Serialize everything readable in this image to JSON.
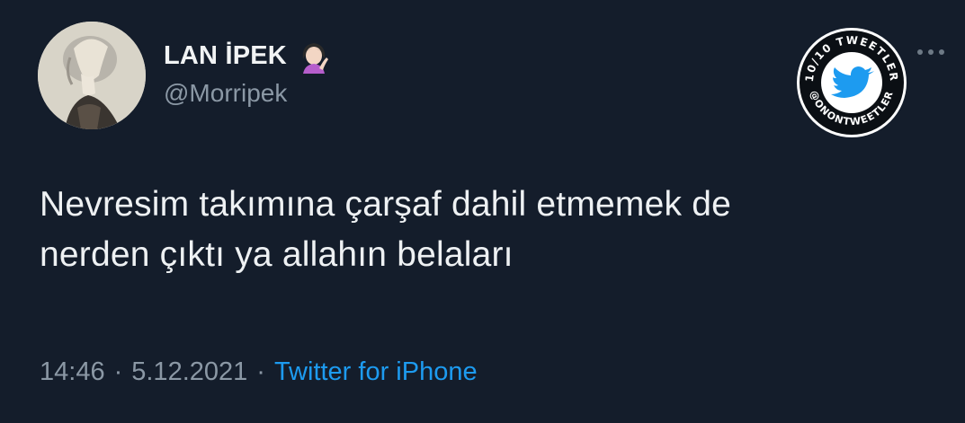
{
  "tweet": {
    "display_name": "LAN İPEK",
    "handle": "@Morripek",
    "text_line1": "Nevresim takımına çarşaf dahil etmemek de",
    "text_line2": "nerden çıktı ya allahın belaları",
    "time": "14:46",
    "separator": "·",
    "date": "5.12.2021",
    "source": "Twitter for iPhone"
  },
  "badge": {
    "top_text": "10/10 TWEETLER",
    "bottom_text": "@ONONTWEETLER"
  },
  "icons": {
    "emoji": "woman-tipping-hand-emoji",
    "more": "more-dots-icon",
    "badge_bird": "twitter-bird-icon"
  },
  "colors": {
    "background": "#141d2b",
    "text": "#eef1f3",
    "secondary": "#8b98a5",
    "link": "#1d9bf0"
  }
}
